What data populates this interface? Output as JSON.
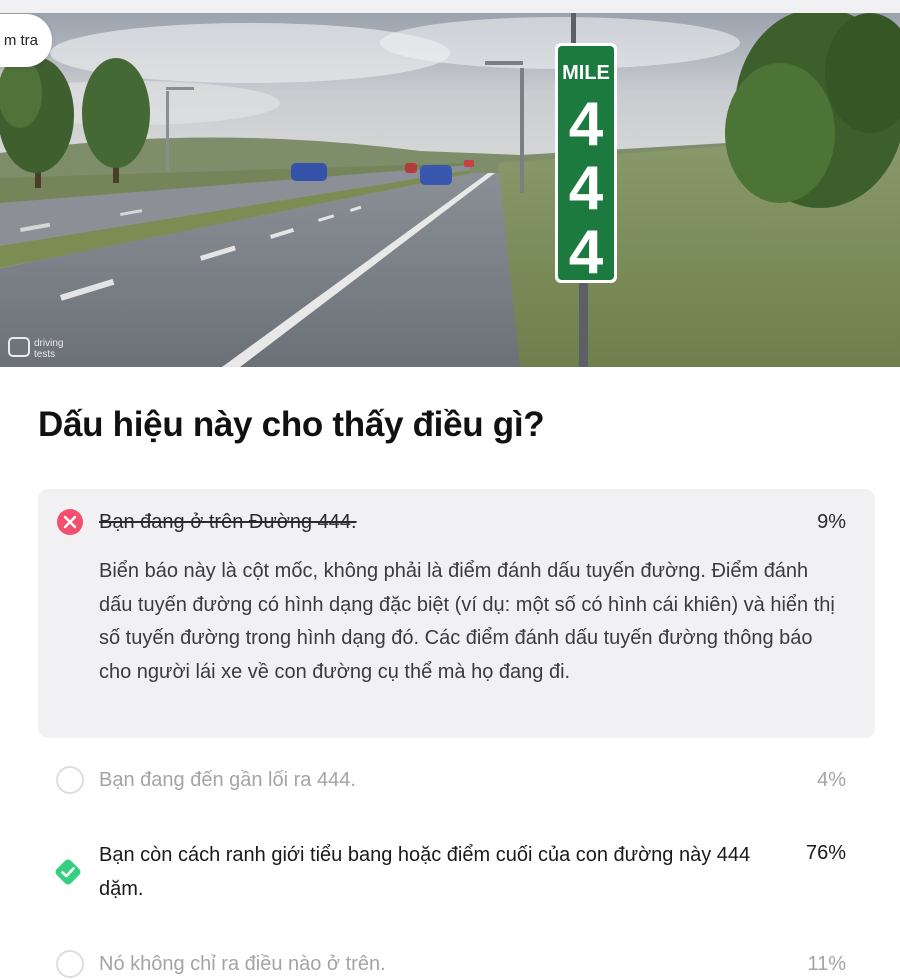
{
  "top_button": {
    "label": "m tra"
  },
  "hero": {
    "sign_header": "MILE",
    "sign_digits": [
      "4",
      "4",
      "4"
    ],
    "watermark": {
      "line1": "driving",
      "line2": "tests"
    }
  },
  "question": "Dấu hiệu này cho thấy điều gì?",
  "answers": [
    {
      "text": "Bạn đang ở trên Đường 444.",
      "percent": "9%",
      "state": "wrong-selected",
      "explanation": "Biển báo này là cột mốc, không phải là điểm đánh dấu tuyến đường. Điểm đánh dấu tuyến đường có hình dạng đặc biệt (ví dụ: một số có hình cái khiên) và hiển thị số tuyến đường trong hình dạng đó. Các điểm đánh dấu tuyến đường thông báo cho người lái xe về con đường cụ thể mà họ đang đi."
    },
    {
      "text": "Bạn đang đến gần lối ra 444.",
      "percent": "4%",
      "state": "unselected"
    },
    {
      "text": "Bạn còn cách ranh giới tiểu bang hoặc điểm cuối của con đường này 444 dặm.",
      "percent": "76%",
      "state": "correct"
    },
    {
      "text": "Nó không chỉ ra điều nào ở trên.",
      "percent": "11%",
      "state": "unselected"
    }
  ],
  "colors": {
    "wrong": "#f0506e",
    "correct": "#35d07f",
    "sign_green": "#1d7a3f",
    "muted_text": "#a4a4a8"
  }
}
